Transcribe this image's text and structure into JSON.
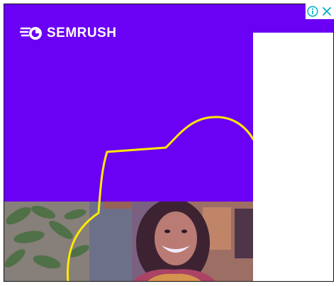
{
  "ad": {
    "brand": "SEMRUSH",
    "icons": {
      "logo": "semrush-fireball-icon",
      "info": "info-icon",
      "close": "close-icon"
    },
    "colors": {
      "background": "#6a00f4",
      "curve": "#ffea00",
      "adchoices": "#00aecd"
    },
    "photo": "smiling-woman-with-curly-hair-and-plant"
  }
}
